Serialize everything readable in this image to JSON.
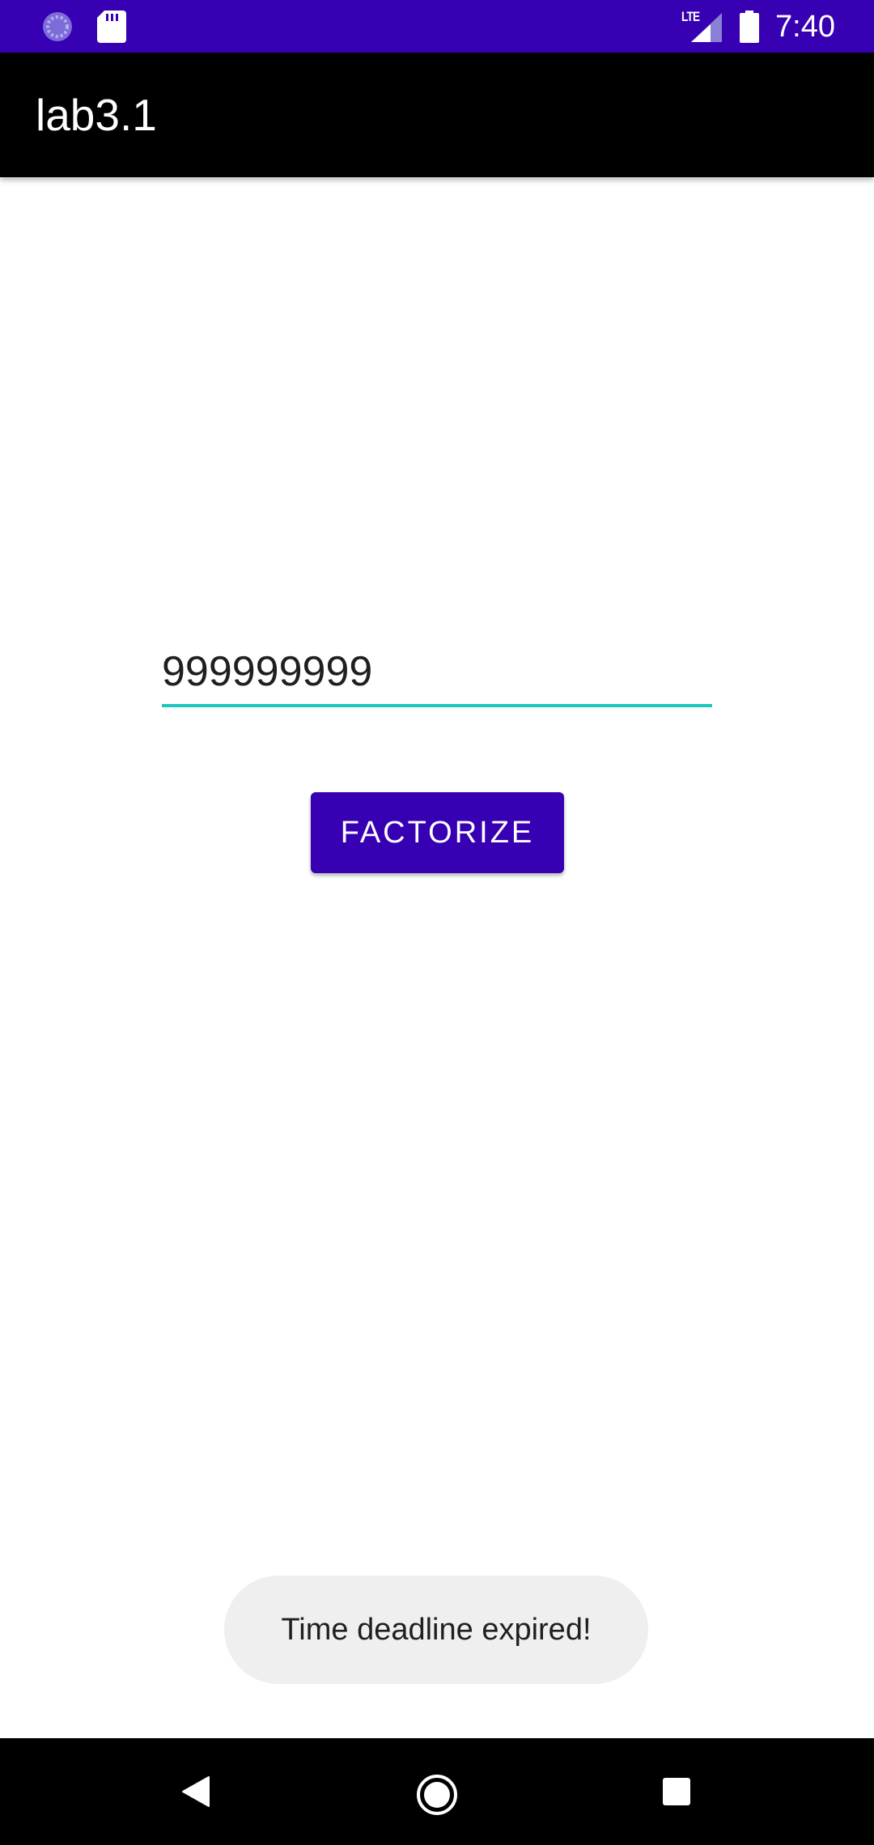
{
  "status_bar": {
    "time": "7:40",
    "network_label": "LTE",
    "icons": [
      "loading-spinner-icon",
      "sd-card-icon",
      "signal-icon",
      "battery-icon"
    ]
  },
  "toolbar": {
    "title": "lab3.1"
  },
  "main": {
    "number_input": {
      "value": "999999999"
    },
    "factorize_button": {
      "label": "FACTORIZE"
    }
  },
  "toast": {
    "message": "Time deadline expired!"
  },
  "navigation_bar": {
    "icons": [
      "back-icon",
      "home-icon",
      "recents-icon"
    ]
  },
  "colors": {
    "primary": "#3700b3",
    "toolbar": "#000000",
    "input_underline": "#18c8bd",
    "toast_background": "#efefef"
  }
}
